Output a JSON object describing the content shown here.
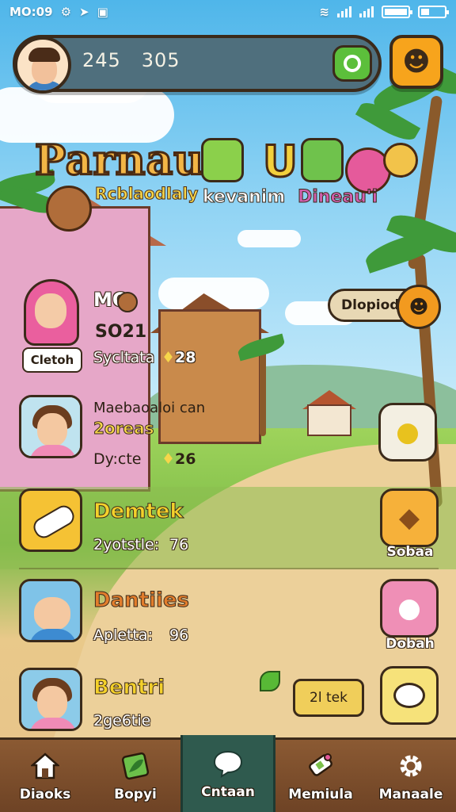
{
  "status_bar": {
    "time": "MO:09",
    "left_icons": [
      "app-icon",
      "send-icon",
      "image-icon"
    ],
    "right_icons": [
      "wifi-icon",
      "signal-icon",
      "signal-icon",
      "battery-icon",
      "battery-icon"
    ]
  },
  "header": {
    "score_text": "245   305",
    "search_icon": "search-icon",
    "emoji_icon": "smiley-face-icon"
  },
  "logo": {
    "title": "Parnau",
    "big_letter": "U",
    "subtitle_left": "Rcblaodlaly",
    "subtitle_mid": "kevanim",
    "subtitle_right": "Dineau'i"
  },
  "hero": {
    "side_title": "MO",
    "side_number": "SO21",
    "name_badge": "Cletoh",
    "stat_label": "Sycltata",
    "stat_value": "28",
    "dropdown_label": "Dlopiod"
  },
  "profile_row": {
    "title_line1": "Maebaoaloi can",
    "title_line2": "2oreas",
    "stat_label": "Dy:cte",
    "stat_value": "26"
  },
  "list": {
    "items": [
      {
        "title": "Demtek",
        "sub_label": "2yotstle:",
        "sub_value": "76",
        "title_color": "#f4d12b",
        "side_label": "Sobaa"
      },
      {
        "title": "Dantiies",
        "sub_label": "Apletta:",
        "sub_value": "96",
        "title_color": "#e27d2c",
        "side_label": "Dobah"
      },
      {
        "title": "Bentri",
        "sub_label": "2ge6tie",
        "sub_value": "",
        "title_color": "#f4d12b",
        "side_label": ""
      }
    ],
    "action_button": "2l tek"
  },
  "bottom_nav": {
    "items": [
      {
        "label": "Diaoks",
        "icon": "home-icon"
      },
      {
        "label": "Bopyi",
        "icon": "leaf-card-icon"
      },
      {
        "label": "Cntaan",
        "icon": "chat-bubble-icon"
      },
      {
        "label": "Memiula",
        "icon": "tag-icon"
      },
      {
        "label": "Manaale",
        "icon": "gear-icon"
      }
    ],
    "active_index": 2
  },
  "colors": {
    "accent_orange": "#f7a41c",
    "nav_brown": "#6e4325",
    "nav_active": "#2f5a4e",
    "search_green": "#5cbf3b"
  }
}
